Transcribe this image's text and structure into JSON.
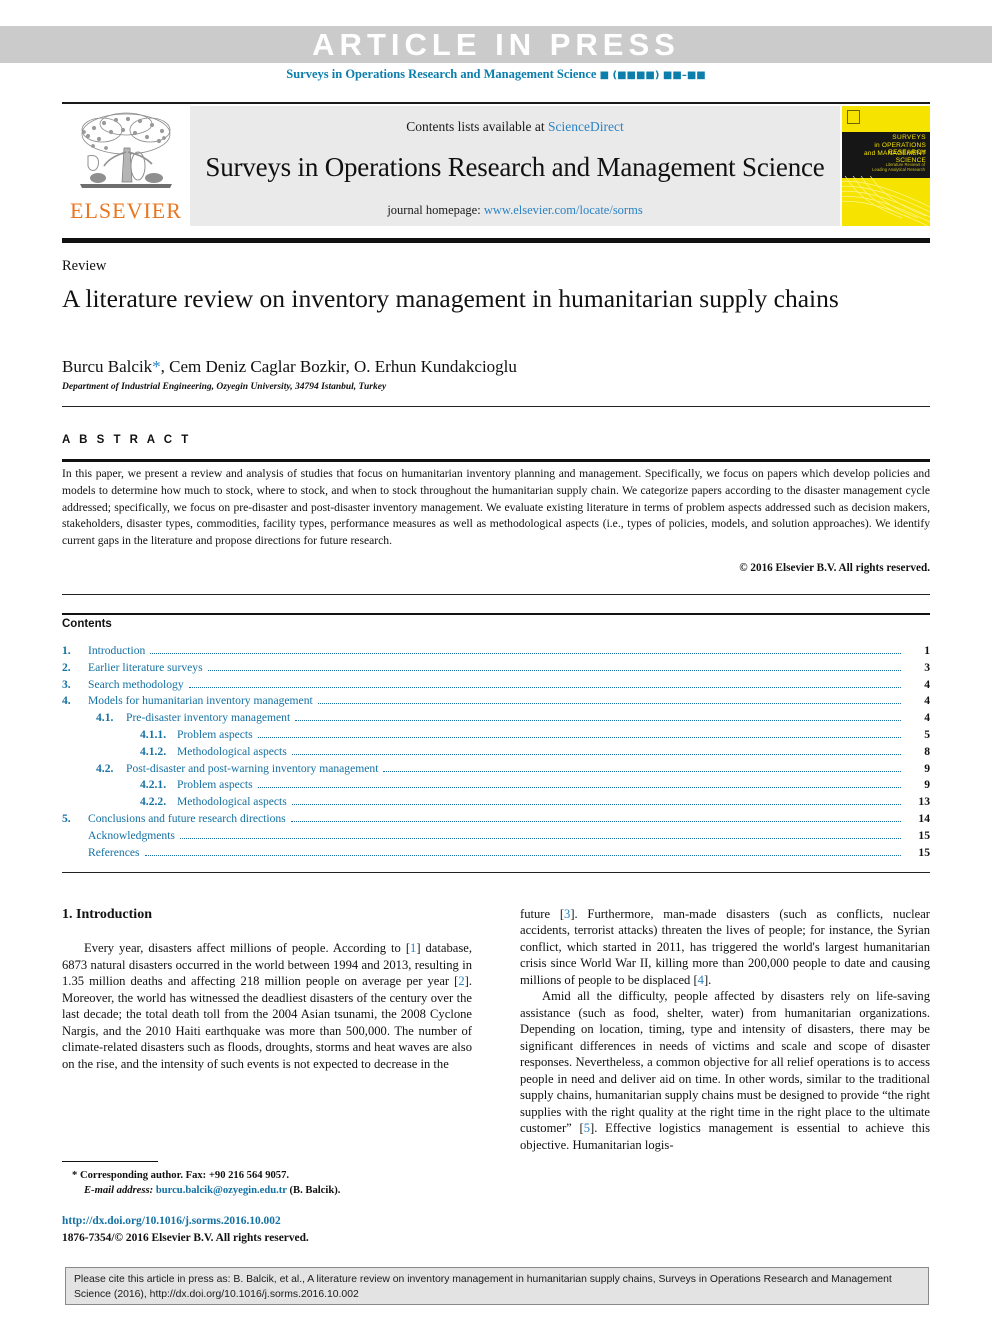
{
  "banner": {
    "article_in_press": "ARTICLE IN PRESS",
    "journal_ref_prefix": "Surveys in Operations Research and Management Science",
    "journal_ref_blocks": "■ (■■■■) ■■–■■",
    "band_color": "#cbcbcb",
    "link_color": "#0b7eab"
  },
  "masthead": {
    "publisher": "ELSEVIER",
    "contents_available": "Contents lists available at",
    "sciencedirect": "ScienceDirect",
    "journal_title": "Surveys in Operations Research and Management Science",
    "homepage_label": "journal homepage:",
    "homepage_url": "www.elsevier.com/locate/sorms",
    "cover": {
      "line1": "SURVEYS",
      "line2": "in OPERATIONS RESEARCH",
      "line3": "and MANAGEMENT SCIENCE",
      "subtitle": "Literature Reviews of\nLeading Analytical Research",
      "bg_color": "#f6e400",
      "band_color": "#161616"
    }
  },
  "article": {
    "kind": "Review",
    "title": "A literature review on inventory management in humanitarian supply chains",
    "authors": "Burcu Balcik",
    "authors_rest": ", Cem Deniz Caglar Bozkir, O. Erhun Kundakcioglu",
    "corresponding_marker": "*",
    "affiliation": "Department of Industrial Engineering, Ozyegin University, 34794 Istanbul, Turkey"
  },
  "abstract": {
    "heading": "A B S T R A C T",
    "body": "In this paper, we present a review and analysis of studies that focus on humanitarian inventory planning and management. Specifically, we focus on papers which develop policies and models to determine how much to stock, where to stock, and when to stock throughout the humanitarian supply chain. We categorize papers according to the disaster management cycle addressed; specifically, we focus on pre-disaster and post-disaster inventory management. We evaluate existing literature in terms of problem aspects addressed such as decision makers, stakeholders, disaster types, commodities, facility types, performance measures as well as methodological aspects (i.e., types of policies, models, and solution approaches). We identify current gaps in the literature and propose directions for future research.",
    "copyright": "© 2016 Elsevier B.V. All rights reserved."
  },
  "contents": {
    "heading": "Contents",
    "link_color": "#1471a3",
    "entries": [
      {
        "level": 1,
        "num": "1.",
        "label": "Introduction",
        "page": "1"
      },
      {
        "level": 1,
        "num": "2.",
        "label": "Earlier literature surveys",
        "page": "3"
      },
      {
        "level": 1,
        "num": "3.",
        "label": "Search methodology",
        "page": "4"
      },
      {
        "level": 1,
        "num": "4.",
        "label": "Models for humanitarian inventory management",
        "page": "4"
      },
      {
        "level": 2,
        "num": "4.1.",
        "label": "Pre-disaster inventory management",
        "page": "4"
      },
      {
        "level": 3,
        "num": "4.1.1.",
        "label": "Problem aspects",
        "page": "5"
      },
      {
        "level": 3,
        "num": "4.1.2.",
        "label": "Methodological aspects",
        "page": "8"
      },
      {
        "level": 2,
        "num": "4.2.",
        "label": "Post-disaster and post-warning inventory management",
        "page": "9"
      },
      {
        "level": 3,
        "num": "4.2.1.",
        "label": "Problem aspects",
        "page": "9"
      },
      {
        "level": 3,
        "num": "4.2.2.",
        "label": "Methodological aspects",
        "page": "13"
      },
      {
        "level": 1,
        "num": "5.",
        "label": "Conclusions and future research directions",
        "page": "14"
      },
      {
        "level": 1,
        "num": "",
        "label": "Acknowledgments",
        "page": "15"
      },
      {
        "level": 1,
        "num": "",
        "label": "References",
        "page": "15"
      }
    ]
  },
  "body": {
    "section_heading": "1. Introduction",
    "left_paragraph_1_a": "Every year, disasters affect millions of people. According to [",
    "left_paragraph_1_ref1": "1",
    "left_paragraph_1_b": "] database, 6873 natural disasters occurred in the world between 1994 and 2013, resulting in 1.35 million deaths and affecting 218 million people on average per year [",
    "left_paragraph_1_ref2": "2",
    "left_paragraph_1_c": "]. Moreover, the world has witnessed the deadliest disasters of the century over the last decade; the total death toll from the 2004 Asian tsunami, the 2008 Cyclone Nargis, and the 2010 Haiti earthquake was more than 500,000. The number of climate-related disasters such as floods, droughts, storms and heat waves are also on the rise, and the intensity of such events is not expected to decrease in the",
    "right_paragraph_1_a": "future [",
    "right_paragraph_1_ref3": "3",
    "right_paragraph_1_b": "]. Furthermore, man-made disasters (such as conflicts, nuclear accidents, terrorist attacks) threaten the lives of people; for instance, the Syrian conflict, which started in 2011, has triggered the world's largest humanitarian crisis since World War II, killing more than 200,000 people to date and causing millions of people to be displaced [",
    "right_paragraph_1_ref4": "4",
    "right_paragraph_1_c": "].",
    "right_paragraph_2_a": "Amid all the difficulty, people affected by disasters rely on life-saving assistance (such as food, shelter, water) from humanitarian organizations. Depending on location, timing, type and intensity of disasters, there may be significant differences in needs of victims and scale and scope of disaster responses. Nevertheless, a common objective for all relief operations is to access people in need and deliver aid on time. In other words, similar to the traditional supply chains, humanitarian supply chains must be designed to provide “the right supplies with the right quality at the right time in the right place to the ultimate customer” [",
    "right_paragraph_2_ref5": "5",
    "right_paragraph_2_b": "]. Effective logistics management is essential to achieve this objective. Humanitarian logis-"
  },
  "footnote": {
    "corresponding": "* Corresponding author. Fax: +90 216 564 9057.",
    "email_label": "E-mail address:",
    "email": "burcu.balcik@ozyegin.edu.tr",
    "email_suffix": "(B. Balcik).",
    "doi": "http://dx.doi.org/10.1016/j.sorms.2016.10.002",
    "issn_line": "1876-7354/© 2016 Elsevier B.V. All rights reserved."
  },
  "citation_box": {
    "text": "Please cite this article in press as: B. Balcik, et al., A literature review on inventory management in humanitarian supply chains, Surveys in Operations Research and Management Science (2016), http://dx.doi.org/10.1016/j.sorms.2016.10.002"
  }
}
